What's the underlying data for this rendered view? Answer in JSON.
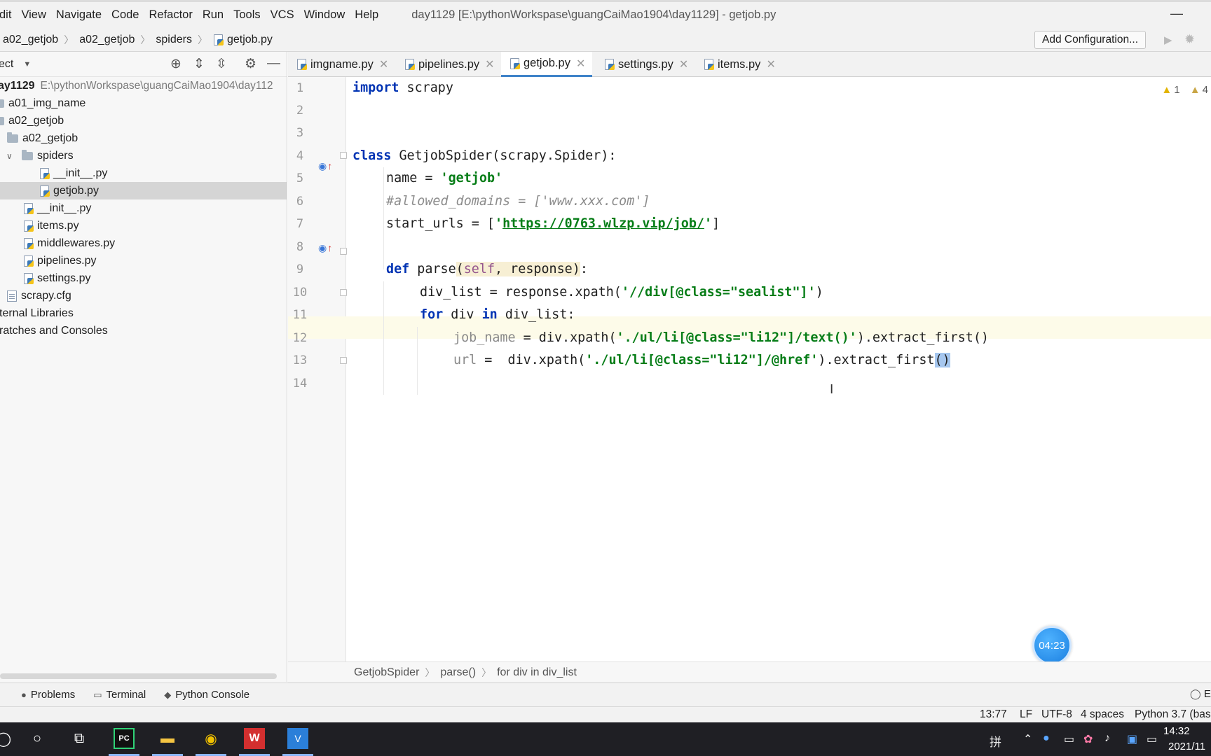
{
  "menu": {
    "items": [
      "dit",
      "View",
      "Navigate",
      "Code",
      "Refactor",
      "Run",
      "Tools",
      "VCS",
      "Window",
      "Help"
    ],
    "window_title": "day1129 [E:\\pythonWorkspase\\guangCaiMao1904\\day1129] - getjob.py",
    "minimize": "—"
  },
  "navbar": {
    "crumbs": [
      "a02_getjob",
      "a02_getjob",
      "spiders",
      "getjob.py"
    ],
    "add_config": "Add Configuration..."
  },
  "project": {
    "header": "ect",
    "tree": [
      {
        "label": "ay1129",
        "path": "E:\\pythonWorkspase\\guangCaiMao1904\\day112"
      },
      {
        "label": "a01_img_name"
      },
      {
        "label": "a02_getjob"
      },
      {
        "label": "a02_getjob"
      },
      {
        "label": "spiders"
      },
      {
        "label": "__init__.py"
      },
      {
        "label": "getjob.py"
      },
      {
        "label": "__init__.py"
      },
      {
        "label": "items.py"
      },
      {
        "label": "middlewares.py"
      },
      {
        "label": "pipelines.py"
      },
      {
        "label": "settings.py"
      },
      {
        "label": "scrapy.cfg"
      },
      {
        "label": "ternal Libraries"
      },
      {
        "label": "ratches and Consoles"
      }
    ]
  },
  "tabs": [
    "imgname.py",
    "pipelines.py",
    "getjob.py",
    "settings.py",
    "items.py"
  ],
  "editor": {
    "line_numbers": [
      "1",
      "2",
      "3",
      "4",
      "5",
      "6",
      "7",
      "8",
      "9",
      "10",
      "11",
      "12",
      "13",
      "14"
    ],
    "code": {
      "l1": [
        "import",
        " scrapy"
      ],
      "l4": [
        "class",
        " GetjobSpider(scrapy.Spider):"
      ],
      "l5": [
        "name = ",
        "'getjob'"
      ],
      "l6": "#allowed_domains = ['www.xxx.com']",
      "l7": [
        "start_urls = [",
        "'",
        "https://0763.wlzp.vip/job/",
        "'",
        "]"
      ],
      "l9": [
        "def",
        " parse",
        "(",
        "self",
        ", response",
        ")",
        ":"
      ],
      "l10": [
        "div_list = response.xpath(",
        "'//div[@class=\"sealist\"]'",
        ")"
      ],
      "l11": [
        "for",
        " div ",
        "in",
        " div_list:"
      ],
      "l12": [
        "job_name",
        " = div.xpath(",
        "'./ul/li[@class=\"li12\"]/text()'",
        ").extract_first()"
      ],
      "l13": [
        "url",
        " =  div.xpath(",
        "'./ul/li[@class=\"li12\"]/@href'",
        ").extract_first",
        "()"
      ]
    },
    "warnings": {
      "warn_count": "1",
      "weak_count": "4"
    },
    "timer": "04:23"
  },
  "editor_breadcrumb": [
    "GetjobSpider",
    "parse()",
    "for div in div_list"
  ],
  "toolwindows": [
    "Problems",
    "Terminal",
    "Python Console"
  ],
  "statusbar": {
    "position": "13:77",
    "line_sep": "LF",
    "encoding": "UTF-8",
    "indent": "4 spaces",
    "interpreter": "Python 3.7 (bas",
    "event_log": "E"
  },
  "taskbar": {
    "ime": "拼",
    "time": "14:32",
    "date": "2021/11"
  }
}
